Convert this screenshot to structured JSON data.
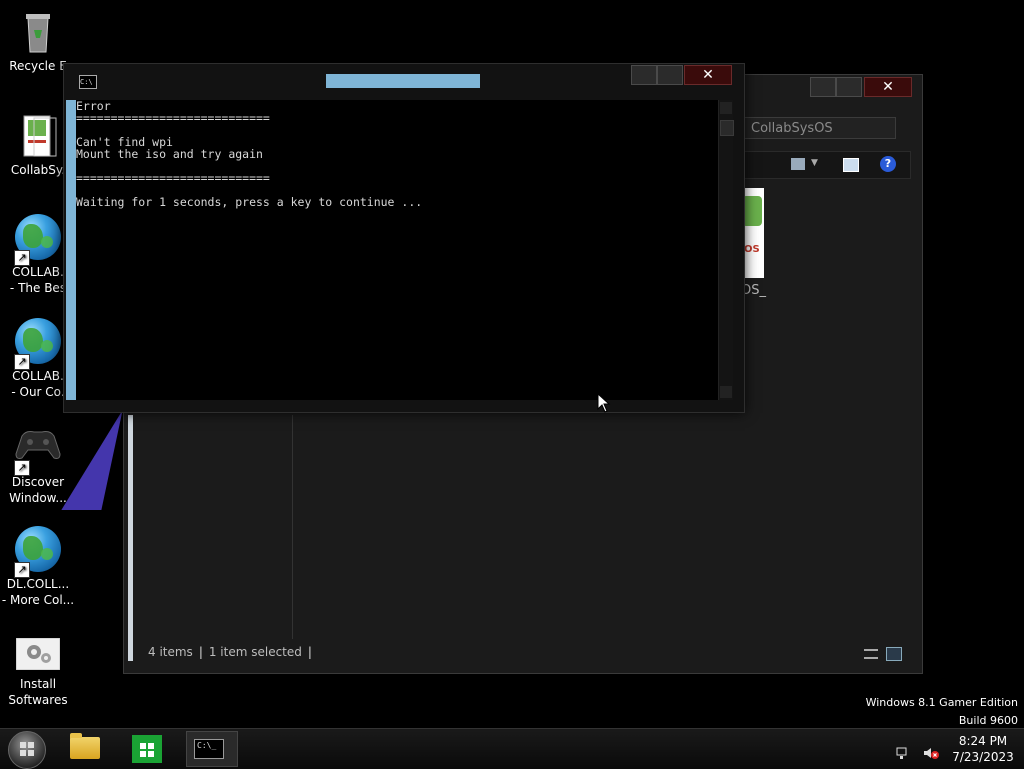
{
  "desktop": {
    "icons": [
      {
        "label": "Recycle E",
        "icon": "recycle-bin-icon"
      },
      {
        "label": "CollabSy.",
        "icon": "document-icon"
      },
      {
        "label": "COLLAB.\n- The Bes",
        "icon": "globe-icon"
      },
      {
        "label": "COLLAB.\n- Our Co.",
        "icon": "globe-icon"
      },
      {
        "label": "Discover\nWindow...",
        "icon": "gamepad-icon"
      },
      {
        "label": "DL.COLL...\n- More Col...",
        "icon": "globe-icon"
      },
      {
        "label": "Install\nSoftwares",
        "icon": "gear-icon"
      }
    ]
  },
  "explorer": {
    "search_placeholder": "CollabSysOS",
    "file_name_partial": "OS_",
    "status": {
      "items": "4 items",
      "selected": "1 item selected"
    }
  },
  "cmd": {
    "title": "",
    "lines": [
      "Error",
      "============================",
      "",
      "Can't find wpi",
      "Mount the iso and try again",
      "",
      "============================",
      "",
      "Waiting for 1 seconds, press a key to continue ..."
    ]
  },
  "watermark": {
    "edition": "Windows 8.1 Gamer Edition",
    "build": "Build 9600"
  },
  "taskbar": {
    "items": [
      "start-button",
      "file-explorer",
      "windows-store",
      "command-prompt"
    ],
    "time": "8:24 PM",
    "date": "7/23/2023"
  }
}
